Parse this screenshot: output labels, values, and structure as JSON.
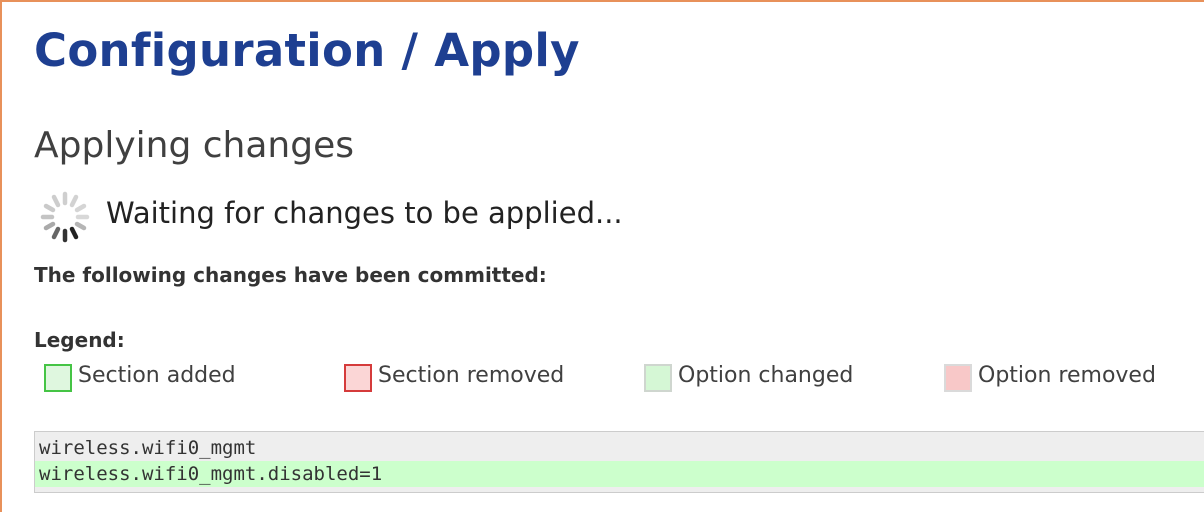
{
  "page": {
    "title": "Configuration / Apply",
    "heading": "Applying changes",
    "status_text": "Waiting for changes to be applied...",
    "committed_title": "The following changes have been committed:"
  },
  "legend": {
    "title": "Legend:",
    "items": [
      {
        "label": "Section added",
        "color": "#45c445",
        "icon": "section-added-swatch"
      },
      {
        "label": "Section removed",
        "color": "#d53b3b",
        "icon": "section-removed-swatch"
      },
      {
        "label": "Option changed",
        "color": "#d5f7d5",
        "icon": "option-changed-swatch"
      },
      {
        "label": "Option removed",
        "color": "#f8c8c8",
        "icon": "option-removed-swatch"
      }
    ]
  },
  "changes": [
    {
      "text": "wireless.wifi0_mgmt",
      "kind": "section"
    },
    {
      "text": "wireless.wifi0_mgmt.disabled=1",
      "kind": "option-changed"
    }
  ],
  "colors": {
    "title": "#1e3f91",
    "frame_border": "#e8915a",
    "changes_background": "#eeeeee",
    "option_changed_background": "#ccffcc"
  },
  "icons": {
    "spinner": "loading-spinner-icon"
  }
}
